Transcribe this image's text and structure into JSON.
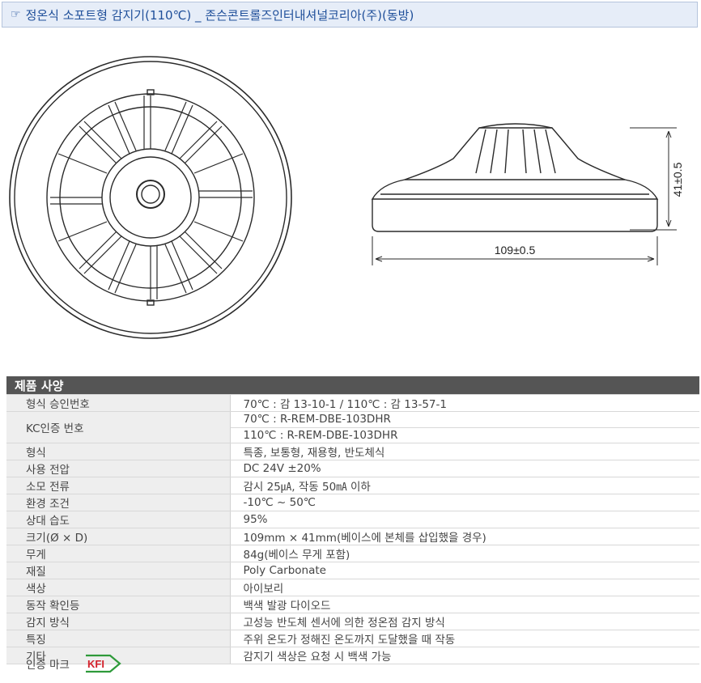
{
  "header": {
    "title": "정온식 소포트형 감지기(110℃) _ 존슨콘트롤즈인터내셔널코리아(주)(동방)",
    "icon": "pointing-hand-icon"
  },
  "drawing": {
    "height_dim": "41±0.5",
    "width_dim": "109±0.5"
  },
  "spec": {
    "title": "제품 사양",
    "rows": [
      {
        "key": "형식 승인번호",
        "values": [
          "70℃ : 감 13-10-1 / 110℃ : 감 13-57-1"
        ]
      },
      {
        "key": "KC인증 번호",
        "values": [
          "70℃ : R-REM-DBE-103DHR",
          "110℃ : R-REM-DBE-103DHR"
        ]
      },
      {
        "key": "형식",
        "values": [
          "특종, 보통형, 재용형, 반도체식"
        ]
      },
      {
        "key": "사용 전압",
        "values": [
          "DC 24V ±20%"
        ]
      },
      {
        "key": "소모 전류",
        "values": [
          "감시 25㎂, 작동 50㎃ 이하"
        ]
      },
      {
        "key": "환경 조건",
        "values": [
          "-10℃ ~ 50℃"
        ]
      },
      {
        "key": "상대 습도",
        "values": [
          "95%"
        ]
      },
      {
        "key": "크기(Ø × D)",
        "values": [
          "109mm × 41mm(베이스에 본체를 삽입했을 경우)"
        ]
      },
      {
        "key": "무게",
        "values": [
          "84g(베이스 무게 포함)"
        ]
      },
      {
        "key": "재질",
        "values": [
          "Poly Carbonate"
        ]
      },
      {
        "key": "색상",
        "values": [
          "아이보리"
        ]
      },
      {
        "key": "동작 확인등",
        "values": [
          "백색 발광 다이오드"
        ]
      },
      {
        "key": "감지 방식",
        "values": [
          "고성능 반도체 센서에 의한 정온점 감지 방식"
        ]
      },
      {
        "key": "특징",
        "values": [
          "주위 온도가 정해진 온도까지 도달했을 때 작동"
        ]
      },
      {
        "key": "기타",
        "values": [
          "감지기 색상은 요청 시 백색 가능"
        ]
      }
    ]
  },
  "cert": {
    "label": "인증 마크",
    "logo_text": "KFI",
    "logo_colors": {
      "green": "#2e9a3a",
      "red": "#d3202a"
    }
  }
}
